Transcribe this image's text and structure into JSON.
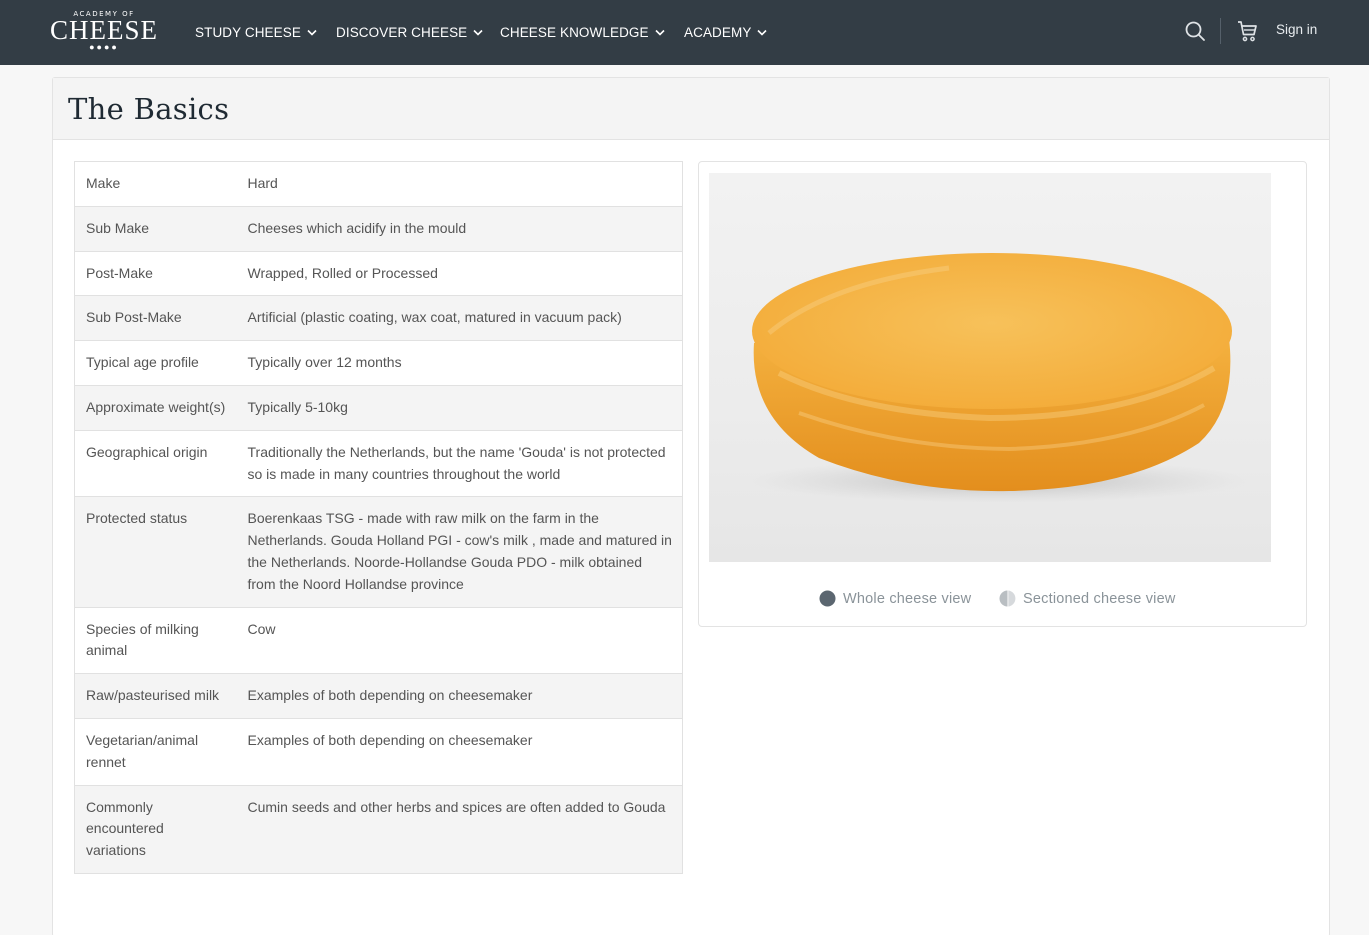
{
  "brand": {
    "top": "ACADEMY OF",
    "main": "CHEESE",
    "dots": "●●●●"
  },
  "nav": {
    "items": [
      {
        "label": "STUDY CHEESE"
      },
      {
        "label": "DISCOVER CHEESE"
      },
      {
        "label": "CHEESE KNOWLEDGE"
      },
      {
        "label": "ACADEMY"
      }
    ],
    "signin": "Sign in"
  },
  "section": {
    "title": "The Basics"
  },
  "details": [
    {
      "label": "Make",
      "value": "Hard"
    },
    {
      "label": "Sub Make",
      "value": "Cheeses which acidify in the mould"
    },
    {
      "label": "Post-Make",
      "value": "Wrapped, Rolled or Processed"
    },
    {
      "label": "Sub Post-Make",
      "value": "Artificial (plastic coating, wax coat, matured in vacuum pack)"
    },
    {
      "label": "Typical age profile",
      "value": "Typically over 12 months"
    },
    {
      "label": "Approximate weight(s)",
      "value": "Typically 5-10kg"
    },
    {
      "label": "Geographical origin",
      "value": "Traditionally the Netherlands, but the name 'Gouda' is not protected so is made in many countries throughout the world"
    },
    {
      "label": "Protected status",
      "value": "Boerenkaas TSG - made with raw milk on the farm in the Netherlands. Gouda Holland PGI - cow's milk , made and matured in the Netherlands. Noorde-Hollandse Gouda PDO - milk obtained from the Noord Hollandse province"
    },
    {
      "label": "Species of milking animal",
      "value": "Cow"
    },
    {
      "label": "Raw/pasteurised milk",
      "value": "Examples of both depending on cheesemaker"
    },
    {
      "label": "Vegetarian/animal rennet",
      "value": "Examples of both depending on cheesemaker"
    },
    {
      "label": "Commonly encountered variations",
      "value": "Cumin seeds and other herbs and spices are often added to Gouda"
    }
  ],
  "views": {
    "whole": "Whole cheese view",
    "sectioned": "Sectioned cheese view"
  },
  "colors": {
    "navbar": "#333d45",
    "cheese": "#f5ad3a",
    "muted": "#8a9399"
  }
}
